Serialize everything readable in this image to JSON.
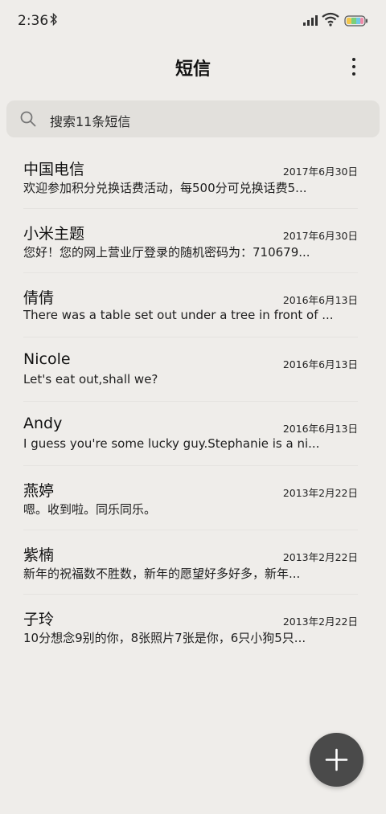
{
  "status_bar": {
    "time": "2:36",
    "bluetooth_icon": "bluetooth-icon",
    "signal_icon": "signal-icon",
    "wifi_icon": "wifi-icon",
    "battery_icon": "battery-icon"
  },
  "header": {
    "title": "短信",
    "more_icon": "more-vertical-icon"
  },
  "search": {
    "icon": "search-icon",
    "placeholder": "搜索11条短信"
  },
  "messages": [
    {
      "sender": "中国电信",
      "date": "2017年6月30日",
      "preview": "欢迎参加积分兑换话费活动，每500分可兑换话费5..."
    },
    {
      "sender": "小米主题",
      "date": "2017年6月30日",
      "preview": "您好！您的网上营业厅登录的随机密码为：710679..."
    },
    {
      "sender": "倩倩",
      "date": "2016年6月13日",
      "preview": "There was a table set out under a tree in front of ..."
    },
    {
      "sender": "Nicole",
      "date": "2016年6月13日",
      "preview": "Let's eat out,shall we?"
    },
    {
      "sender": "Andy",
      "date": "2016年6月13日",
      "preview": "I guess you're some lucky guy.Stephanie is a ni..."
    },
    {
      "sender": "燕婷",
      "date": "2013年2月22日",
      "preview": "嗯。收到啦。同乐同乐。"
    },
    {
      "sender": "紫楠",
      "date": "2013年2月22日",
      "preview": "新年的祝福数不胜数，新年的愿望好多好多，新年..."
    },
    {
      "sender": "子玲",
      "date": "2013年2月22日",
      "preview": "10分想念9别的你，8张照片7张是你，6只小狗5只..."
    }
  ],
  "fab": {
    "icon": "plus-icon"
  },
  "colors": {
    "background": "#efedea",
    "search_bg": "#e2e0dc",
    "fab_bg": "#4a4a4a"
  }
}
